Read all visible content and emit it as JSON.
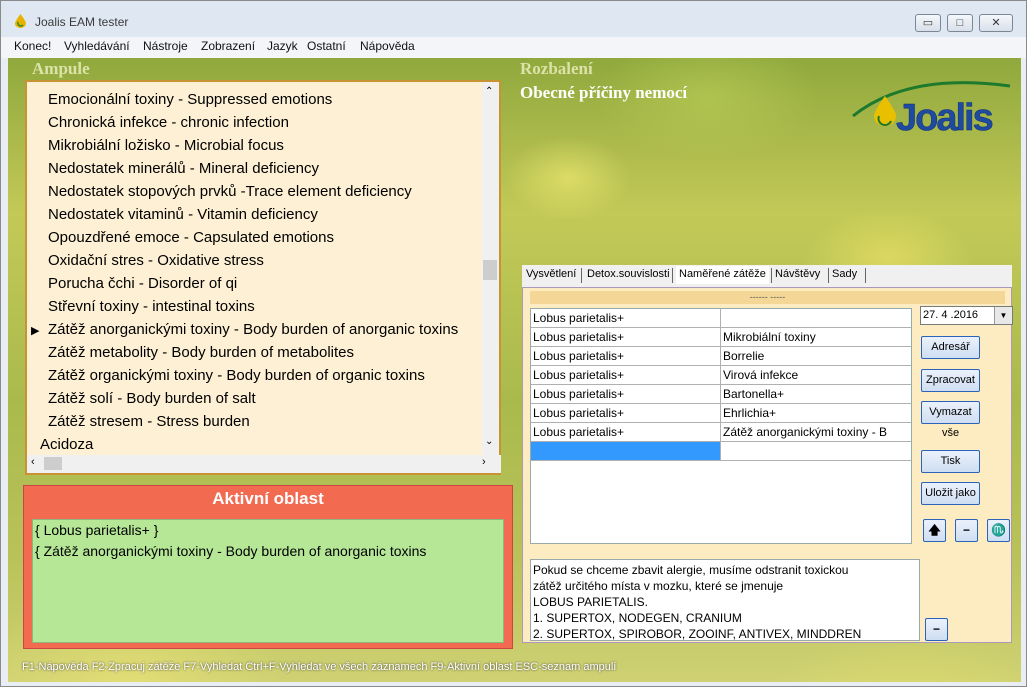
{
  "window": {
    "title": "Joalis EAM tester"
  },
  "menu": [
    "Konec!",
    "Vyhledávání",
    "Nástroje",
    "Zobrazení",
    "Jazyk",
    "Ostatní",
    "Nápověda"
  ],
  "left": {
    "title": "Ampule",
    "items": [
      "Emocionální toxiny -  Suppressed emotions",
      "Chronická infekce - chronic infection",
      "Mikrobiální ložisko - Microbial focus",
      "Nedostatek minerálů - Mineral deficiency",
      "Nedostatek stopových prvků -Trace element deficiency",
      "Nedostatek vitaminů - Vitamin deficiency",
      "Opouzdřené emoce - Capsulated emotions",
      "Oxidační stres - Oxidative stress",
      "Porucha čchi - Disorder of qi",
      "Střevní toxiny - intestinal toxins",
      "Zátěž anorganickými toxiny - Body burden of anorganic toxins",
      "Zátěž metabolity - Body burden of  metabolites",
      "Zátěž organickými toxiny - Body burden of organic toxins",
      "Zátěž solí - Body burden of salt",
      "Zátěž stresem - Stress burden",
      "Acidoza"
    ]
  },
  "active": {
    "title": "Aktivní oblast",
    "lines": [
      "{ Lobus parietalis+ }",
      "{  Zátěž anorganickými toxiny - Body burden of anorganic toxins"
    ]
  },
  "right": {
    "title": "Rozbalení",
    "subtitle": "Obecné příčiny nemocí",
    "logo_text": "Joalis",
    "tabs": [
      "Vysvětlení",
      "Detox.souvislosti",
      "Naměřené zátěže",
      "Návštěvy",
      "Sady"
    ],
    "dash_text": "------ -----",
    "rows": [
      [
        "Lobus parietalis+",
        ""
      ],
      [
        "Lobus parietalis+",
        "Mikrobiální toxiny"
      ],
      [
        "Lobus parietalis+",
        "Borrelie"
      ],
      [
        "Lobus parietalis+",
        "Virová infekce"
      ],
      [
        "Lobus parietalis+",
        "Bartonella+"
      ],
      [
        "Lobus parietalis+",
        "Ehrlichia+"
      ],
      [
        "Lobus parietalis+",
        "  Zátěž anorganickými toxiny - B"
      ]
    ],
    "date": "27. 4 .2016",
    "buttons": [
      "Adresář",
      "Zpracovat",
      "Vymazat vše",
      "Tisk",
      "Uložit jako"
    ],
    "info": [
      "Pokud se chceme zbavit alergie, musíme odstranit toxickou",
      "zátěž určitého místa v mozku, které se jmenuje",
      "LOBUS PARIETALIS.",
      "1. SUPERTOX, NODEGEN, CRANIUM",
      "2. SUPERTOX, SPIROBOR, ZOOINF, ANTIVEX, MINDDREN"
    ]
  },
  "status": "F1-Nápověda   F2-Zpracuj zátěže   F7-Vyhledat   Ctrl+F-Vyhledat ve všech záznamech   F9-Aktivní oblast   ESC-seznam ampulí"
}
